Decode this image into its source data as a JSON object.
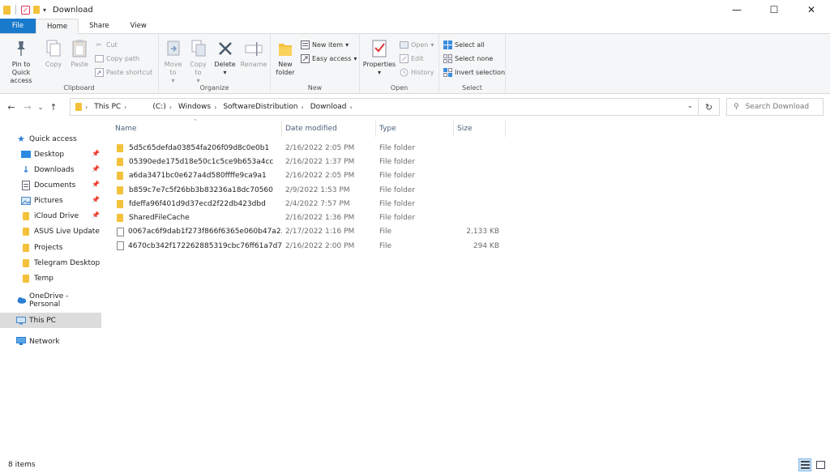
{
  "window": {
    "title": "Download"
  },
  "titlebar": {
    "minimize": "—",
    "maximize": "☐",
    "close": "✕"
  },
  "ribbon_tabs": [
    "File",
    "Home",
    "Share",
    "View"
  ],
  "ribbon": {
    "clipboard": {
      "label": "Clipboard",
      "pin": "Pin to Quick access",
      "copy": "Copy",
      "paste": "Paste",
      "cut": "Cut",
      "copy_path": "Copy path",
      "paste_shortcut": "Paste shortcut"
    },
    "organize": {
      "label": "Organize",
      "move_to": "Move to",
      "copy_to": "Copy to",
      "delete": "Delete",
      "rename": "Rename"
    },
    "new": {
      "label": "New",
      "new_folder": "New folder",
      "new_item": "New item",
      "easy_access": "Easy access"
    },
    "open": {
      "label": "Open",
      "properties": "Properties",
      "open": "Open",
      "edit": "Edit",
      "history": "History"
    },
    "select": {
      "label": "Select",
      "select_all": "Select all",
      "select_none": "Select none",
      "invert": "Invert selection"
    }
  },
  "address": {
    "crumbs": [
      "This PC",
      "(C:)",
      "Windows",
      "SoftwareDistribution",
      "Download"
    ],
    "search_placeholder": "Search Download"
  },
  "sidebar": {
    "quick_access": "Quick access",
    "items": [
      {
        "label": "Desktop",
        "pinned": true
      },
      {
        "label": "Downloads",
        "pinned": true
      },
      {
        "label": "Documents",
        "pinned": true
      },
      {
        "label": "Pictures",
        "pinned": true
      },
      {
        "label": "iCloud Drive",
        "pinned": true
      },
      {
        "label": "ASUS Live Update",
        "pinned": false
      },
      {
        "label": "Projects",
        "pinned": false
      },
      {
        "label": "Telegram Desktop",
        "pinned": false
      },
      {
        "label": "Temp",
        "pinned": false
      }
    ],
    "onedrive": "OneDrive - Personal",
    "this_pc": "This PC",
    "network": "Network"
  },
  "columns": {
    "name": "Name",
    "date": "Date modified",
    "type": "Type",
    "size": "Size"
  },
  "files": [
    {
      "name": "5d5c65defda03854fa206f09d8c0e0b1",
      "date": "2/16/2022 2:05 PM",
      "type": "File folder",
      "size": "",
      "kind": "folder"
    },
    {
      "name": "05390ede175d18e50c1c5ce9b653a4cc",
      "date": "2/16/2022 1:37 PM",
      "type": "File folder",
      "size": "",
      "kind": "folder"
    },
    {
      "name": "a6da3471bc0e627a4d580ffffe9ca9a1",
      "date": "2/16/2022 2:05 PM",
      "type": "File folder",
      "size": "",
      "kind": "folder"
    },
    {
      "name": "b859c7e7c5f26bb3b83236a18dc70560",
      "date": "2/9/2022 1:53 PM",
      "type": "File folder",
      "size": "",
      "kind": "folder"
    },
    {
      "name": "fdeffa96f401d9d37ecd2f22db423dbd",
      "date": "2/4/2022 7:57 PM",
      "type": "File folder",
      "size": "",
      "kind": "folder"
    },
    {
      "name": "SharedFileCache",
      "date": "2/16/2022 1:36 PM",
      "type": "File folder",
      "size": "",
      "kind": "folder"
    },
    {
      "name": "0067ac6f9dab1f273f866f6365e060b47a2...",
      "date": "2/17/2022 1:16 PM",
      "type": "File",
      "size": "2,133 KB",
      "kind": "file"
    },
    {
      "name": "4670cb342f172262885319cbc76ff61a7d7...",
      "date": "2/16/2022 2:00 PM",
      "type": "File",
      "size": "294 KB",
      "kind": "file"
    }
  ],
  "status": {
    "count": "8 items"
  },
  "colors": {
    "file_tab": "#1979ca",
    "folder": "#f3c13a",
    "accent": "#0078d7",
    "header_text": "#4c607a"
  }
}
